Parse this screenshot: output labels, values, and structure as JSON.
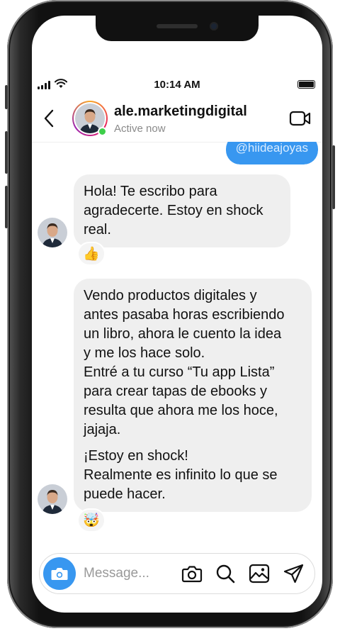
{
  "status_bar": {
    "time": "10:14 AM"
  },
  "header": {
    "username": "ale.marketingdigital",
    "status": "Active now",
    "icons": {
      "back": "chevron-left-icon",
      "video": "video-camera-icon"
    }
  },
  "sent_message": {
    "text": "@hiideajoyas"
  },
  "messages": [
    {
      "text": "Hola! Te escribo para\nagradecerte. Estoy en shock\nreal.",
      "reaction": "👍"
    },
    {
      "text": "Vendo productos digitales y\nantes pasaba horas escribiendo\nun libro, ahora le cuento la idea\ny me los hace solo.\nEntré a tu curso “Tu app Lista”\npara crear tapas de ebooks y\nresulta que ahora me los hoce,\njajaja.",
      "text2": "¡Estoy en shock!\nRealmente es infinito lo que se\npuede hacer.",
      "reaction": "🤯"
    }
  ],
  "composer": {
    "placeholder": "Message...",
    "icons": [
      "camera-icon",
      "camera-outline-icon",
      "search-icon",
      "gallery-icon",
      "send-icon"
    ]
  },
  "colors": {
    "accent": "#3897f0",
    "bubble": "#efefef",
    "active": "#3ecf4a"
  }
}
